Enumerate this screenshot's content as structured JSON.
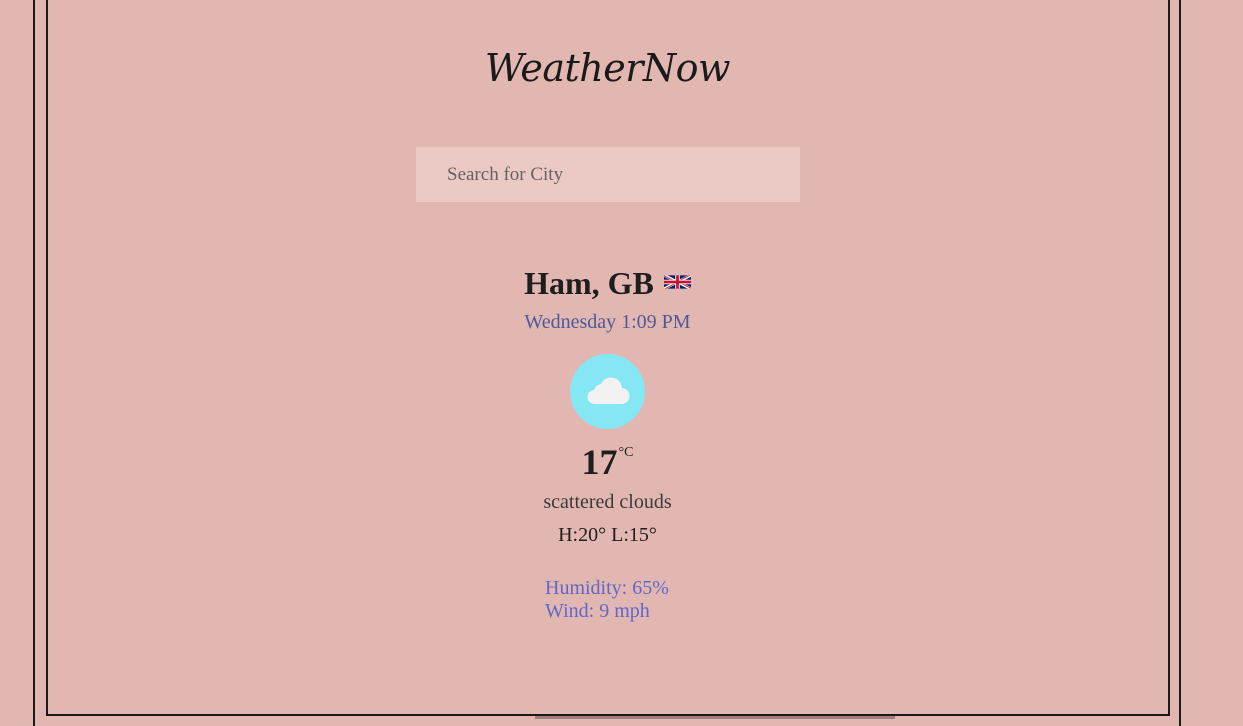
{
  "app": {
    "title": "WeatherNow"
  },
  "search": {
    "placeholder": "Search for City",
    "value": ""
  },
  "weather": {
    "location": "Ham, GB",
    "flag_icon": "uk-flag-icon",
    "datetime": "Wednesday 1:09 PM",
    "condition_icon": "cloud-icon",
    "temperature": "17",
    "unit": "°C",
    "description": "scattered clouds",
    "high_low": "H:20° L:15°",
    "humidity": "Humidity: 65%",
    "wind": "Wind: 9 mph"
  },
  "colors": {
    "background": "#e3b7b1",
    "search_bg": "#ebcac6",
    "icon_bg": "#85e6f4",
    "datetime_text": "#4c5a98",
    "details_text": "#5f68c8"
  }
}
